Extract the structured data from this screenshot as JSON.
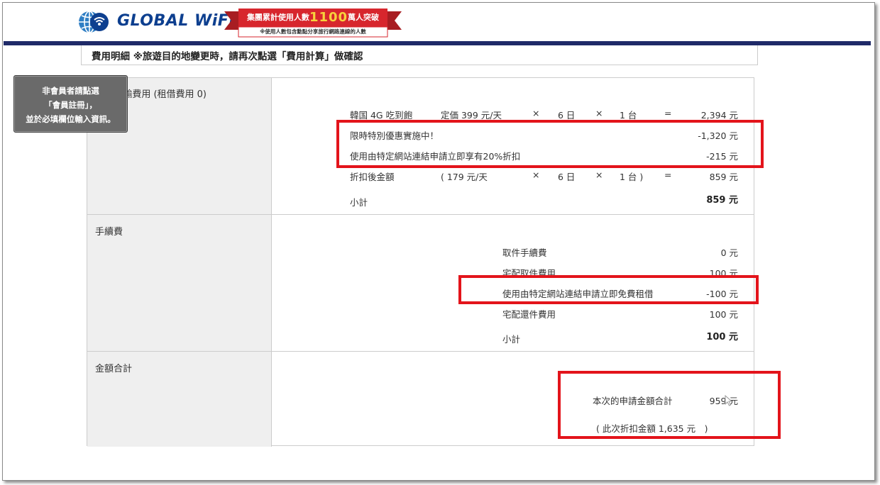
{
  "header": {
    "logo_text": "GLOBAL WiFi",
    "banner_main_prefix": "集團累計使用人數",
    "banner_main_number": "1100",
    "banner_main_suffix": "萬人突破",
    "banner_note": "※使用人數包含勳點分享旅行網路連線的人數"
  },
  "section": {
    "title": "費用明細 ※旅遊目的地變更時，請再次點選「費用計算」做確認"
  },
  "tooltip": {
    "line1": "非會員者請點選",
    "line2": "「會員註冊」，",
    "line3": "並於必填欄位輸入資訊。"
  },
  "rental": {
    "row_title": "WiFi傳輸費用 (租借費用 0)",
    "base": {
      "plan": "韓国 4G 吃到飽",
      "price_label": "定価 399 元/天",
      "times1": "×",
      "days": "6 日",
      "times2": "×",
      "units": "1 台",
      "equals": "=",
      "amount": "2,394 元"
    },
    "promo": {
      "label": "限時特別優惠實施中！",
      "amount": "-1,320 元"
    },
    "link_discount": {
      "label": "使用由特定網站連結申請立即享有20%折扣",
      "amount": "-215 元"
    },
    "after": {
      "label": "折扣後金額",
      "price_label": "( 179 元/天",
      "times1": "×",
      "days": "6 日",
      "times2": "×",
      "units": "1 台 )",
      "equals": "=",
      "amount": "859 元"
    },
    "subtotal_label": "小計",
    "subtotal_amount": "859 元"
  },
  "fees": {
    "row_title": "手續費",
    "items": [
      {
        "label": "取件手續費",
        "amount": "0 元"
      },
      {
        "label": "宅配取件費用",
        "amount": "100 元"
      },
      {
        "label": "使用由特定網站連結申請立即免費租借",
        "amount": "-100 元"
      },
      {
        "label": "宅配還件費用",
        "amount": "100 元"
      }
    ],
    "subtotal_label": "小計",
    "subtotal_amount": "100 元"
  },
  "total": {
    "row_title": "金額合計",
    "label": "本次的申請金額合計",
    "amount": "959 元",
    "discount_note": "( 此次折扣金額 1,635 元　)"
  },
  "colors": {
    "accent_red": "#e3141b",
    "navy": "#1f2a68",
    "logo_blue": "#0d3f8f"
  }
}
